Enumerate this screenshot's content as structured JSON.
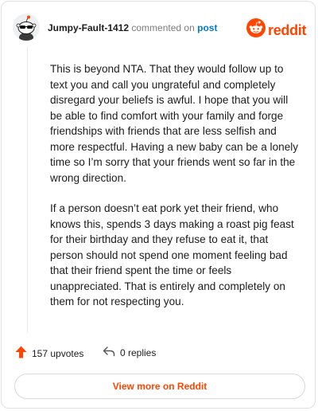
{
  "header": {
    "username": "Jumpy-Fault-1412",
    "action_text": "commented on",
    "post_link": "post",
    "brand_name": "reddit"
  },
  "comment": {
    "paragraphs": [
      "This is beyond NTA. That they would follow up to text you and call you ungrateful and completely disregard your beliefs is awful. I hope that you will be able to find comfort with your family and forge friendships with friends that are less selfish and more respectful. Having a new baby can be a lonely time so I’m sorry that your friends went so far in the wrong direction.",
      "If a person doesn’t eat pork yet their friend, who knows this, spends 3 days making a roast pig feast for their birthday and they refuse to eat it, that person should not spend one moment feeling bad that their friend spent the time or feels unappreciated. That is entirely and completely on them for not respecting you."
    ]
  },
  "footer": {
    "upvotes": "157 upvotes",
    "replies": "0 replies",
    "cta_label": "View more on Reddit"
  },
  "icons": {
    "avatar": "snoo-avatar-icon",
    "brand": "reddit-logo-icon",
    "upvote": "upvote-arrow-icon",
    "reply": "reply-arrow-icon"
  },
  "colors": {
    "brand": "#ff4500",
    "link": "#0079d3",
    "muted": "#7c7c7c"
  }
}
